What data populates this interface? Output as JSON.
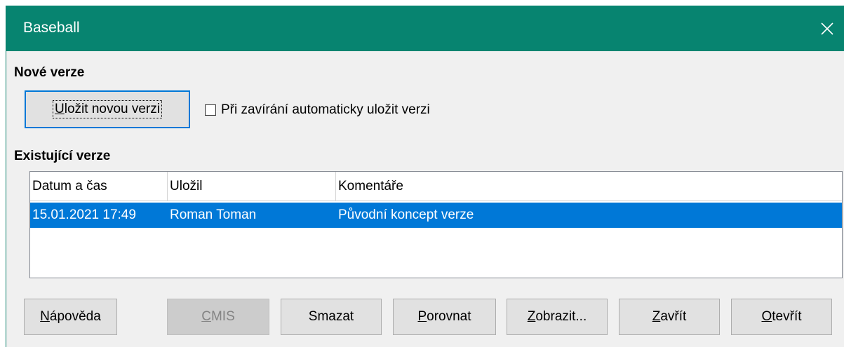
{
  "window": {
    "title": "Baseball"
  },
  "new_versions": {
    "heading": "Nové verze",
    "save_button": "Uložit novou verzi",
    "autosave_checkbox": {
      "label": "Při zavírání automaticky uložit verzi",
      "checked": false
    }
  },
  "existing_versions": {
    "heading": "Existující verze",
    "columns": [
      "Datum a čas",
      "Uložil",
      "Komentáře"
    ],
    "rows": [
      {
        "date": "15.01.2021 17:49",
        "author": "Roman Toman",
        "comment": "Původní koncept verze",
        "selected": true
      }
    ]
  },
  "buttons": {
    "help": "Nápověda",
    "cmis": "CMIS",
    "delete": "Smazat",
    "compare": "Porovnat",
    "show": "Zobrazit...",
    "close": "Zavřít",
    "open": "Otevřít"
  },
  "colors": {
    "titlebar": "#078470",
    "selection": "#0078d7",
    "focus_border": "#0078d7"
  }
}
